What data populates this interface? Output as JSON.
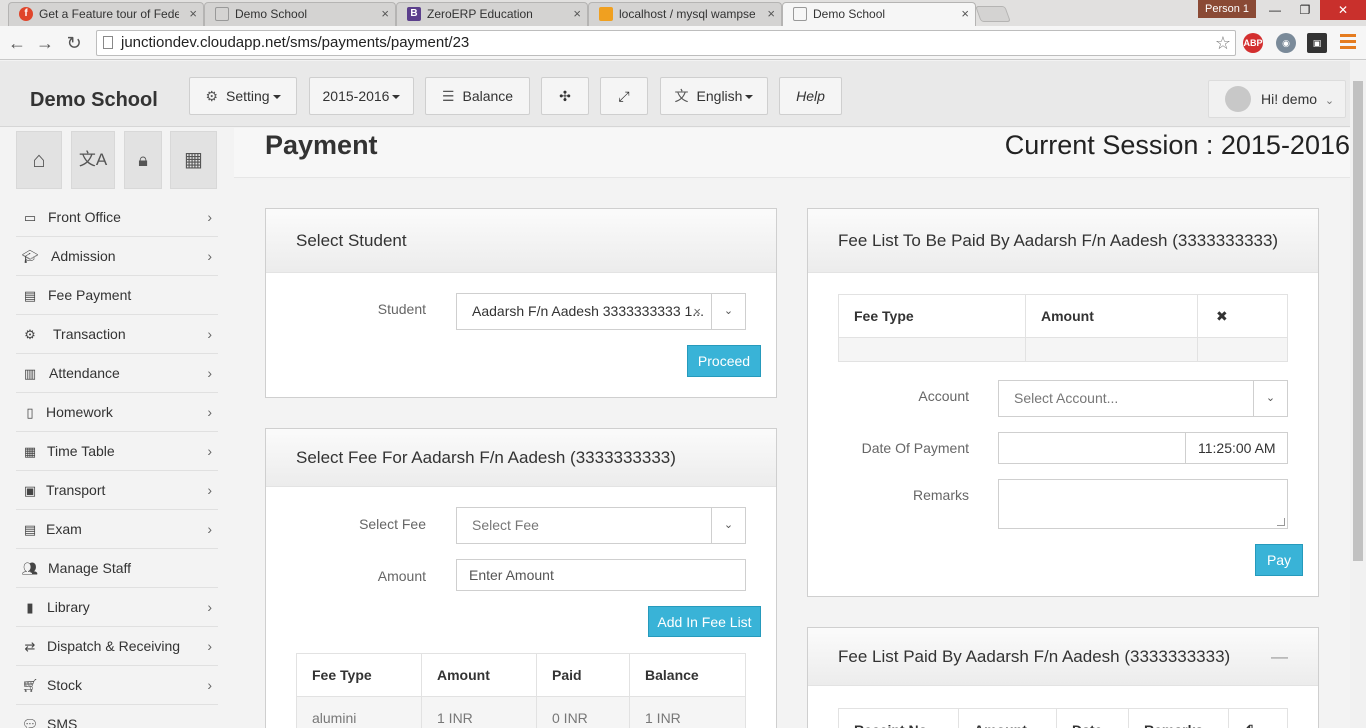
{
  "browser": {
    "tabs": [
      {
        "title": "Get a Feature tour of Fede",
        "favicon_color": "#e0452b",
        "favicon_letter": "f"
      },
      {
        "title": "Demo School",
        "favicon_color": "#999999",
        "favicon_letter": ""
      },
      {
        "title": "ZeroERP Education",
        "favicon_color": "#5b3f8c",
        "favicon_letter": "B"
      },
      {
        "title": "localhost / mysql wampse",
        "favicon_color": "#f0a020",
        "favicon_letter": ""
      },
      {
        "title": "Demo School",
        "favicon_color": "#999999",
        "favicon_letter": ""
      }
    ],
    "person": "Person 1",
    "url": "junctiondev.cloudapp.net/sms/payments/payment/23",
    "ext_abp": "ABP"
  },
  "header": {
    "brand": "Demo School",
    "setting": "Setting",
    "session": "2015-2016",
    "balance": "Balance",
    "language": "English",
    "help": "Help",
    "user": "Hi! demo"
  },
  "sidebar": {
    "items": [
      {
        "label": "Front Office",
        "icon": "monitor-icon",
        "has_children": true
      },
      {
        "label": "Admission",
        "icon": "graduation-cap-icon",
        "has_children": true
      },
      {
        "label": "Fee Payment",
        "icon": "money-icon",
        "has_children": false
      },
      {
        "label": "Transaction",
        "icon": "gear-icon",
        "has_children": true
      },
      {
        "label": "Attendance",
        "icon": "bar-chart-icon",
        "has_children": true
      },
      {
        "label": "Homework",
        "icon": "book-icon",
        "has_children": true
      },
      {
        "label": "Time Table",
        "icon": "calendar-icon",
        "has_children": true
      },
      {
        "label": "Transport",
        "icon": "bus-icon",
        "has_children": true
      },
      {
        "label": "Exam",
        "icon": "file-icon",
        "has_children": true
      },
      {
        "label": "Manage Staff",
        "icon": "users-icon",
        "has_children": false
      },
      {
        "label": "Library",
        "icon": "library-book-icon",
        "has_children": true
      },
      {
        "label": "Dispatch & Receiving",
        "icon": "exchange-icon",
        "has_children": true
      },
      {
        "label": "Stock",
        "icon": "cart-icon",
        "has_children": true
      },
      {
        "label": "SMS",
        "icon": "comment-icon",
        "has_children": false
      }
    ]
  },
  "page": {
    "title": "Payment",
    "session": "Current Session : 2015-2016"
  },
  "select_student": {
    "heading": "Select Student",
    "student_label": "Student",
    "student_value": "Aadarsh F/n Aadesh 3333333333 1...",
    "proceed": "Proceed"
  },
  "select_fee": {
    "heading": "Select Fee For Aadarsh F/n Aadesh (3333333333)",
    "fee_label": "Select Fee",
    "fee_placeholder": "Select Fee",
    "amount_label": "Amount",
    "amount_placeholder": "Enter Amount",
    "add_button": "Add In Fee List",
    "columns": [
      "Fee Type",
      "Amount",
      "Paid",
      "Balance"
    ],
    "rows": [
      [
        "alumini",
        "1 INR",
        "0 INR",
        "1 INR"
      ]
    ]
  },
  "fee_to_pay": {
    "heading": "Fee List To Be Paid By Aadarsh F/n Aadesh (3333333333)",
    "columns": [
      "Fee Type",
      "Amount"
    ],
    "remove_symbol": "✖",
    "account_label": "Account",
    "account_placeholder": "Select Account...",
    "date_label": "Date Of Payment",
    "date_value": "",
    "time_value": "11:25:00 AM",
    "remarks_label": "Remarks",
    "pay": "Pay"
  },
  "fee_paid": {
    "heading": "Fee List Paid By Aadarsh F/n Aadesh (3333333333)",
    "collapse_symbol": "—",
    "columns": [
      "Receipt No",
      "Amount",
      "Date",
      "Remarks"
    ]
  }
}
